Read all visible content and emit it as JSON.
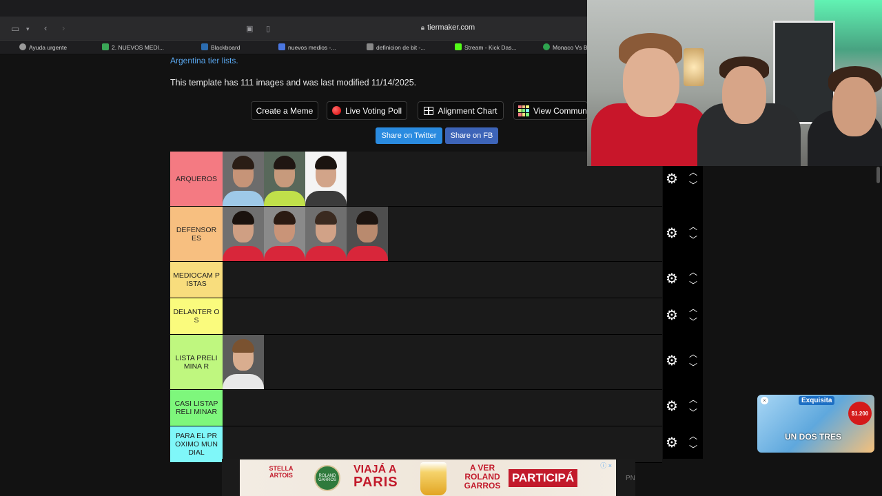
{
  "browser": {
    "url": "tiermaker.com",
    "bookmarks": [
      {
        "label": "Ayuda urgente",
        "color": "#9a9a9a"
      },
      {
        "label": "2. NUEVOS MEDI...",
        "color": "#3aa757"
      },
      {
        "label": "Blackboard",
        "color": "#2b6cb0"
      },
      {
        "label": "nuevos medios -...",
        "color": "#4a76e0"
      },
      {
        "label": "definicion de bit -...",
        "color": "#888888"
      },
      {
        "label": "Stream - Kick Das...",
        "color": "#53fc18"
      },
      {
        "label": "Monaco Vs B",
        "color": "#2ea44f"
      }
    ]
  },
  "page": {
    "link_line": "Argentina tier lists.",
    "template_info": "This template has 111 images and was last modified 11/14/2025.",
    "buttons": {
      "create_meme": "Create a Meme",
      "live_poll": "Live Voting Poll",
      "alignment_chart": "Alignment Chart",
      "view_community": "View Commun"
    },
    "share": {
      "twitter": "Share on Twitter",
      "facebook": "Share on FB",
      "twitter_color": "#2a8be0",
      "facebook_color": "#3d64b8"
    }
  },
  "tiers": [
    {
      "label": "ARQUEROS",
      "color": "#f47a82",
      "items": 3
    },
    {
      "label": "DEFENSOR ES",
      "color": "#f7bf80",
      "items": 4
    },
    {
      "label": "MEDIOCAM PISTAS",
      "color": "#f8dd7d",
      "items": 0
    },
    {
      "label": "DELANTER OS",
      "color": "#fafb7d",
      "items": 0
    },
    {
      "label": "LISTA PRELIMINA R",
      "color": "#bff77f",
      "items": 1
    },
    {
      "label": "CASI LISTAPRELI MINAR",
      "color": "#7ef77c",
      "items": 0
    },
    {
      "label": "PARA EL PROXIMO MUNDIAL",
      "color": "#7ff7f9",
      "items": 0
    }
  ],
  "ads": {
    "small": {
      "brand": "Exquisita",
      "price": "$1.200",
      "tagline": "UN DOS TRES"
    },
    "bottom": {
      "line1": "VIAJÁ A",
      "line2": "PARIS",
      "line3": "A VER ROLAND GARROS",
      "cta": "PARTICIPÁ",
      "logo1": "STELLA ARTOIS",
      "logo2": "ROLAND GARROS"
    },
    "pn_label": "PN"
  }
}
